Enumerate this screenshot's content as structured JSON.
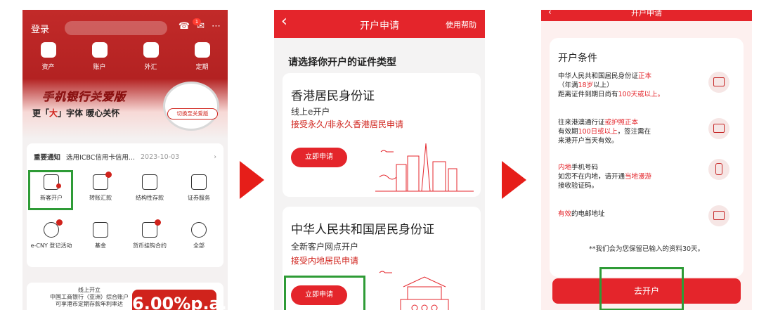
{
  "colors": {
    "accent": "#e4252b",
    "highlight": "#2e9b36",
    "brand_dark": "#b32222"
  },
  "screen1": {
    "header": {
      "login": "登录",
      "message_badge": "1"
    },
    "quick_links": [
      "资产",
      "账户",
      "外汇",
      "定期"
    ],
    "banner": {
      "title": "手机银行关爱版",
      "subtitle_pre": "更「",
      "subtitle_em": "大",
      "subtitle_post": "」字体 暖心关怀",
      "switch_button": "切换至关爱版"
    },
    "notice": {
      "tag": "重要通知",
      "text": "选用ICBC信用卡信用...",
      "date": "2023-10-03",
      "chevron": "›"
    },
    "grid": [
      {
        "label": "新客开户",
        "icon": "new-account-icon"
      },
      {
        "label": "转账汇款",
        "icon": "transfer-icon"
      },
      {
        "label": "结构性存款",
        "icon": "structured-deposit-icon"
      },
      {
        "label": "证券服务",
        "icon": "securities-icon"
      },
      {
        "label": "e-CNY 登记活动",
        "icon": "ecny-icon"
      },
      {
        "label": "基金",
        "icon": "fund-icon"
      },
      {
        "label": "货币挂钩合约",
        "icon": "currency-linked-icon"
      },
      {
        "label": "全部",
        "icon": "all-services-icon"
      }
    ],
    "promo": {
      "line1": "线上开立",
      "line2": "中国工商银行（亚洲）综合账户",
      "line3": "可享港币定期存款年利率达",
      "rate": "6.00%p.a."
    }
  },
  "screen2": {
    "nav": {
      "back": "‹",
      "title": "开户申请",
      "help": "使用帮助"
    },
    "subtitle": "请选择你开户的证件类型",
    "cards": [
      {
        "title": "香港居民身份证",
        "sub": "线上e开户",
        "requirement": "接受永久/非永久香港居民申请",
        "button": "立即申请"
      },
      {
        "title": "中华人民共和国居民身份证",
        "sub": "全新客户网点开户",
        "requirement": "接受内地居民申请",
        "button": "立即申请"
      }
    ]
  },
  "screen3": {
    "nav": {
      "back": "‹",
      "title": "开户申请"
    },
    "heading": "开户条件",
    "items": {
      "id": {
        "l1a": "中华人民共和国居民身份证",
        "l1b": "正本",
        "l2a": "（年满",
        "l2b": "18岁",
        "l2c": "以上）",
        "l3a": "距离证件到期日尚有",
        "l3b": "100天或以上",
        "l3c": "。"
      },
      "permit": {
        "l1a": "往来港澳通行证",
        "l1b": "或护照正本",
        "l2a": "有效期",
        "l2b": "100日或以上",
        "l2c": "，签注需在",
        "l3": "来港开户当天有效。"
      },
      "phone": {
        "l1a": "内地",
        "l1b": "手机号码",
        "l2a": "如您不在内地，请开通",
        "l2b": "当地漫游",
        "l3": "接收验证码。"
      },
      "email": {
        "l1a": "有效",
        "l1b": "的电邮地址"
      }
    },
    "note": "**我们会为您保留已输入的资料30天。",
    "button": "去开户"
  }
}
